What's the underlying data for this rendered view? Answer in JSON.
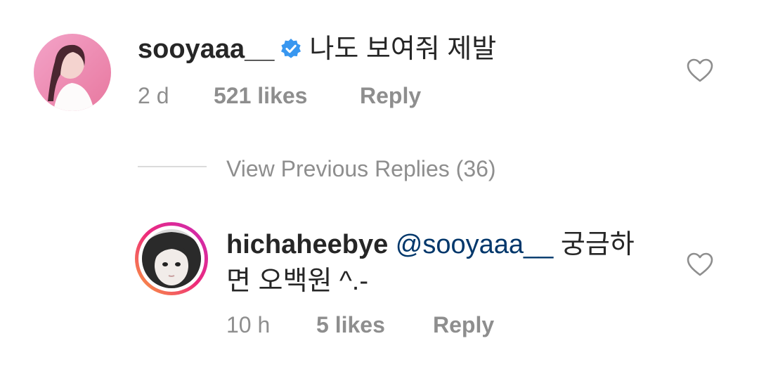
{
  "comment1": {
    "username": "sooyaaa__",
    "verified": true,
    "text": "나도 보여줘 제발",
    "time": "2 d",
    "likes": "521 likes",
    "reply_label": "Reply"
  },
  "view_previous_replies": "View Previous Replies (36)",
  "reply1": {
    "username": "hichaheebye",
    "mention": "@sooyaaa__",
    "text_line1": "궁금하",
    "text_line2": "면 오백원 ^.-",
    "time": "10 h",
    "likes": "5 likes",
    "reply_label": "Reply"
  },
  "colors": {
    "text": "#262626",
    "meta": "#8e8e8e",
    "mention": "#00376b",
    "verified": "#3897f0",
    "divider": "#dbdbdb"
  },
  "icons": {
    "verified": "verified-badge-icon",
    "like": "heart-outline-icon"
  }
}
